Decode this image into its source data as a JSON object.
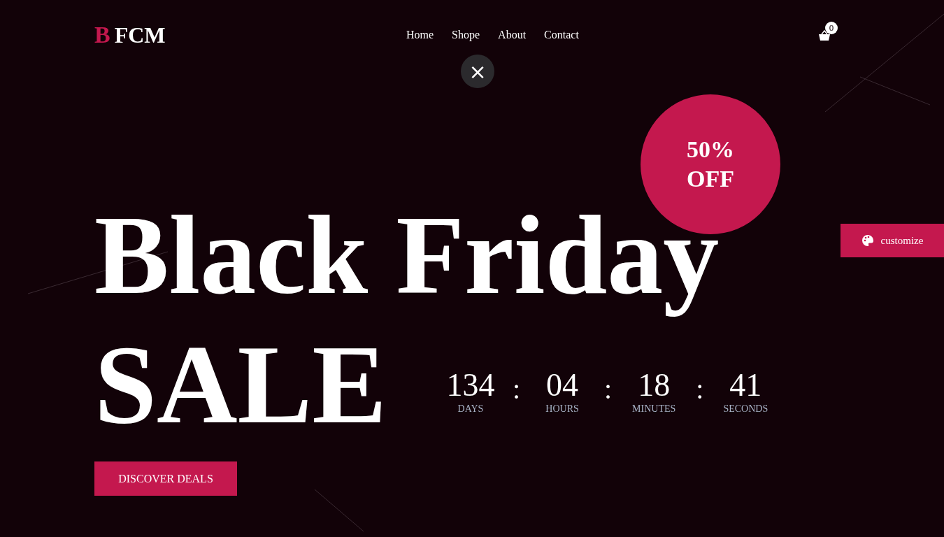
{
  "logo": {
    "initial": "B",
    "rest": "FCM"
  },
  "nav": [
    {
      "label": "Home"
    },
    {
      "label": "Shope"
    },
    {
      "label": "About"
    },
    {
      "label": "Contact"
    }
  ],
  "cart": {
    "count": "0"
  },
  "close_button": {
    "label": "×"
  },
  "hero": {
    "title_line_1": "Black Friday",
    "title_line_2": "SALE",
    "badge": {
      "line_1": "50%",
      "line_2": "OFF"
    }
  },
  "countdown": [
    {
      "value": "134",
      "unit": "DAYS"
    },
    {
      "value": "04",
      "unit": "HOURS"
    },
    {
      "value": "18",
      "unit": "MINUTES"
    },
    {
      "value": "41",
      "unit": "SECONDS"
    }
  ],
  "countdown_separator": ":",
  "cta": {
    "label": "DISCOVER DEALS"
  },
  "customize": {
    "label": "customize"
  }
}
